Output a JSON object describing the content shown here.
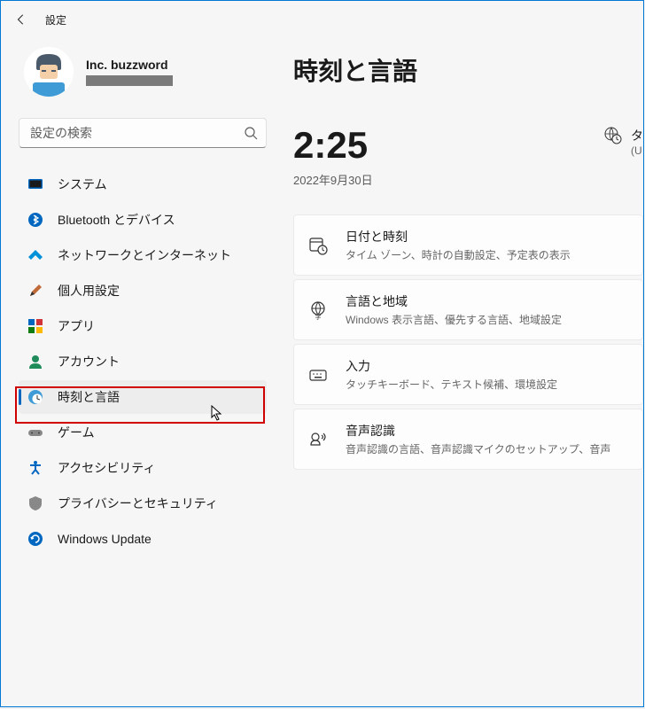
{
  "app_title": "設定",
  "user": {
    "name": "Inc. buzzword"
  },
  "search": {
    "placeholder": "設定の検索"
  },
  "sidebar": {
    "items": [
      {
        "label": "システム"
      },
      {
        "label": "Bluetooth とデバイス"
      },
      {
        "label": "ネットワークとインターネット"
      },
      {
        "label": "個人用設定"
      },
      {
        "label": "アプリ"
      },
      {
        "label": "アカウント"
      },
      {
        "label": "時刻と言語"
      },
      {
        "label": "ゲーム"
      },
      {
        "label": "アクセシビリティ"
      },
      {
        "label": "プライバシーとセキュリティ"
      },
      {
        "label": "Windows Update"
      }
    ]
  },
  "page": {
    "title": "時刻と言語",
    "clock_time": "2:25",
    "clock_date": "2022年9月30日",
    "tz_label_1": "タ",
    "tz_label_2": "(U"
  },
  "cards": [
    {
      "title": "日付と時刻",
      "sub": "タイム ゾーン、時計の自動設定、予定表の表示"
    },
    {
      "title": "言語と地域",
      "sub": "Windows 表示言語、優先する言語、地域設定"
    },
    {
      "title": "入力",
      "sub": "タッチキーボード、テキスト候補、環境設定"
    },
    {
      "title": "音声認識",
      "sub": "音声認識の言語、音声認識マイクのセットアップ、音声"
    }
  ]
}
